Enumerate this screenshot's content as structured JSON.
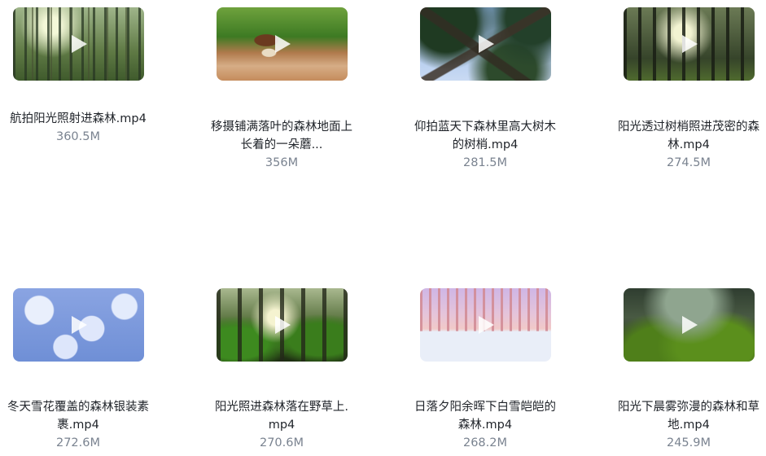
{
  "videos": [
    {
      "name": "航拍阳光照射进森林.mp4",
      "size": "360.5M",
      "thumb_desc": "sunlit-forest-aerial"
    },
    {
      "name_line1": "移摄铺满落叶的森林地面上",
      "name_line2": "长着的一朵蘑...",
      "size": "356M",
      "thumb_desc": "mushroom-on-forest-floor"
    },
    {
      "name_line1": "仰拍蓝天下森林里高大树木",
      "name_line2": "的树梢.mp4",
      "size": "281.5M",
      "thumb_desc": "tree-tops-blue-sky"
    },
    {
      "name_line1": "阳光透过树梢照进茂密的森",
      "name_line2": "林.mp4",
      "size": "274.5M",
      "thumb_desc": "sunlight-dense-forest"
    },
    {
      "name_line1": "冬天雪花覆盖的森林银装素",
      "name_line2": "裹.mp4",
      "size": "272.6M",
      "thumb_desc": "snow-covered-forest"
    },
    {
      "name_line1": "阳光照进森林落在野草上.",
      "name_line2": "mp4",
      "size": "270.6M",
      "thumb_desc": "sunlight-on-wild-grass"
    },
    {
      "name_line1": "日落夕阳余晖下白雪皑皑的",
      "name_line2": "森林.mp4",
      "size": "268.2M",
      "thumb_desc": "sunset-snowy-forest"
    },
    {
      "name_line1": "阳光下晨雾弥漫的森林和草",
      "name_line2": "地.mp4",
      "size": "245.9M",
      "thumb_desc": "morning-mist-forest-meadow"
    }
  ],
  "icons": {
    "play": "play-icon"
  }
}
